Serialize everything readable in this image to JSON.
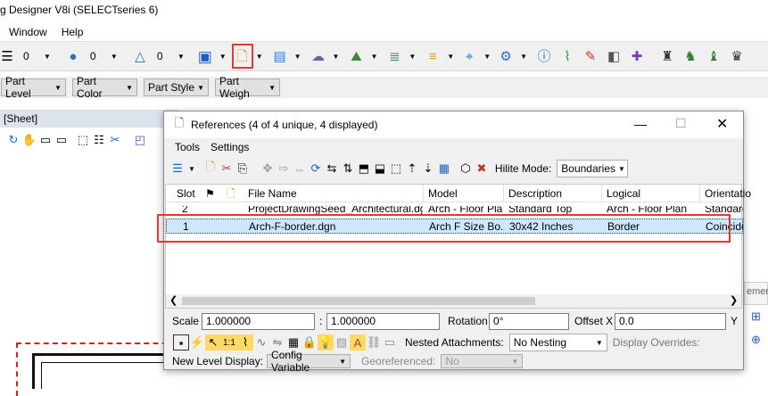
{
  "app": {
    "title": "g Designer V8i (SELECTseries 6)",
    "menu": [
      "Window",
      "Help"
    ],
    "toolbar_values": [
      "0",
      "0",
      "0"
    ],
    "attr_dropdowns": [
      "Part Level",
      "Part Color",
      "Part Style",
      "Part Weigh"
    ],
    "sheet_tab": "[Sheet]"
  },
  "dialog": {
    "title": "References (4 of 4 unique, 4 displayed)",
    "menu": [
      "Tools",
      "Settings"
    ],
    "hilite_label": "Hilite Mode:",
    "hilite_value": "Boundaries",
    "columns": [
      "Slot",
      "File Name",
      "Model",
      "Description",
      "Logical",
      "Orientatio"
    ],
    "rows": [
      {
        "slot": "2",
        "file": "ProjectDrawingSeed_Architectural.dgnlib",
        "model": "Arch - Floor Plan",
        "desc": "Standard Top",
        "logical": "Arch - Floor Plan",
        "orient": "Standard"
      },
      {
        "slot": "1",
        "file": "Arch-F-border.dgn",
        "model": "Arch F Size Bo...",
        "desc": "30x42 Inches",
        "logical": "Border",
        "orient": "Coincider"
      }
    ],
    "scale_label": "Scale",
    "scale_1": "1.000000",
    "scale_sep": ":",
    "scale_2": "1.000000",
    "rotation_label": "Rotation",
    "rotation": "0°",
    "offset_label": "Offset X",
    "offset_x": "0.0",
    "offset_y_label": "Y",
    "nested_label": "Nested Attachments:",
    "nested_value": "No Nesting",
    "display_overrides_label": "Display Overrides:",
    "new_level_label": "New Level Display:",
    "new_level_value": "Config Variable",
    "georef_label": "Georeferenced:",
    "georef_value": "No",
    "side_snippet": "emen"
  },
  "colors": {
    "highlight": "#e8353a",
    "title_bg": "#ffffff",
    "toolbar_bg": "#f0f0f0",
    "selection": "#cce8ff"
  },
  "icons": [
    "new-file-icon",
    "sphere-icon",
    "triangle-icon",
    "cube-icon",
    "references-icon",
    "info-icon"
  ]
}
